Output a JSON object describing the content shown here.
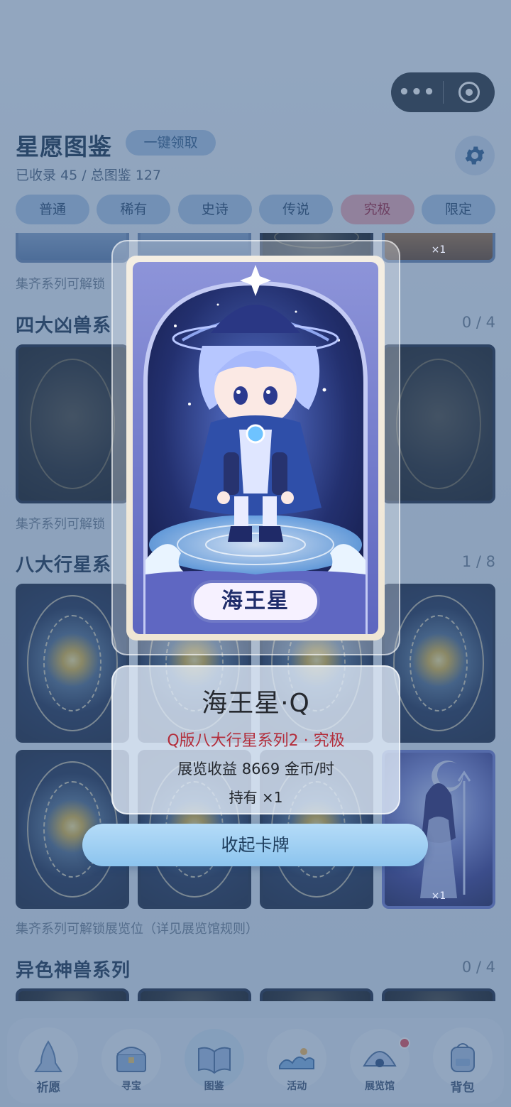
{
  "capsule": {
    "more_icon": "more-dots-icon",
    "close_icon": "target-circle-icon"
  },
  "header": {
    "title": "星愿图鉴",
    "claim_button": "一键领取",
    "subtitle": "已收录 45 / 总图鉴 127",
    "settings_icon": "gear-icon"
  },
  "tabs": [
    {
      "label": "普通"
    },
    {
      "label": "稀有"
    },
    {
      "label": "史诗"
    },
    {
      "label": "传说"
    },
    {
      "label": "究极"
    },
    {
      "label": "限定"
    }
  ],
  "gallery": {
    "top_partial_count": "×1",
    "note_1": "集齐系列可解锁",
    "series_1": {
      "title": "四大凶兽系",
      "count": "0 / 4"
    },
    "note_2": "集齐系列可解锁",
    "series_2": {
      "title": "八大行星系",
      "count": "1 / 8"
    },
    "series_2_card_count": "×1",
    "note_3": "集齐系列可解锁展览位（详见展览馆规则）",
    "series_3": {
      "title": "异色神兽系列",
      "count": "0 / 4"
    }
  },
  "card_modal": {
    "card_title": "海王星",
    "name": "海王星·Q",
    "series": "Q版八大行星系列2 · 究极",
    "income": "展览收益 8669 金币/时",
    "hold": "持有 ×1",
    "close_button": "收起卡牌"
  },
  "nav": [
    {
      "label": "祈愿",
      "icon": "praying-hands-icon"
    },
    {
      "label": "寻宝",
      "icon": "treasure-chest-icon"
    },
    {
      "label": "图鉴",
      "icon": "open-book-icon"
    },
    {
      "label": "活动",
      "icon": "ocean-wave-icon"
    },
    {
      "label": "展览馆",
      "icon": "shell-pearl-icon"
    },
    {
      "label": "背包",
      "icon": "backpack-icon"
    }
  ],
  "colors": {
    "accent": "#e7a6b5",
    "rarity_text": "#b32e3c",
    "button": "#8cc4ee"
  }
}
